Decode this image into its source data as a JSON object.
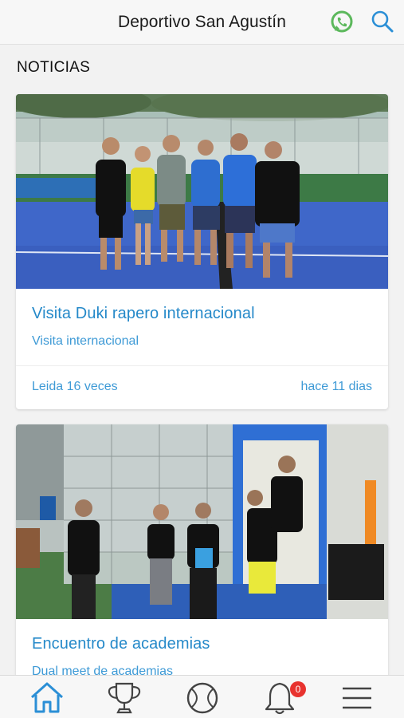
{
  "header": {
    "title": "Deportivo San Agustín",
    "whatsapp_icon": "whatsapp-icon",
    "search_icon": "search-icon",
    "accent_green": "#5cb85c",
    "accent_blue": "#2b8fd6"
  },
  "section": {
    "title": "NOTICIAS"
  },
  "news": [
    {
      "title": "Visita Duki rapero internacional",
      "subtitle": "Visita internacional",
      "reads": "Leida 16 veces",
      "age": "hace 11 dias",
      "image": "group photo of six people on padel court"
    },
    {
      "title": "Encuentro de academias",
      "subtitle": "Dual meet de academias",
      "image": "kids with rackets at padel court"
    }
  ],
  "tabbar": {
    "items": [
      "home-icon",
      "trophy-icon",
      "ball-icon",
      "bell-icon",
      "menu-icon"
    ],
    "active": "home-icon",
    "notifications_count": "0"
  }
}
